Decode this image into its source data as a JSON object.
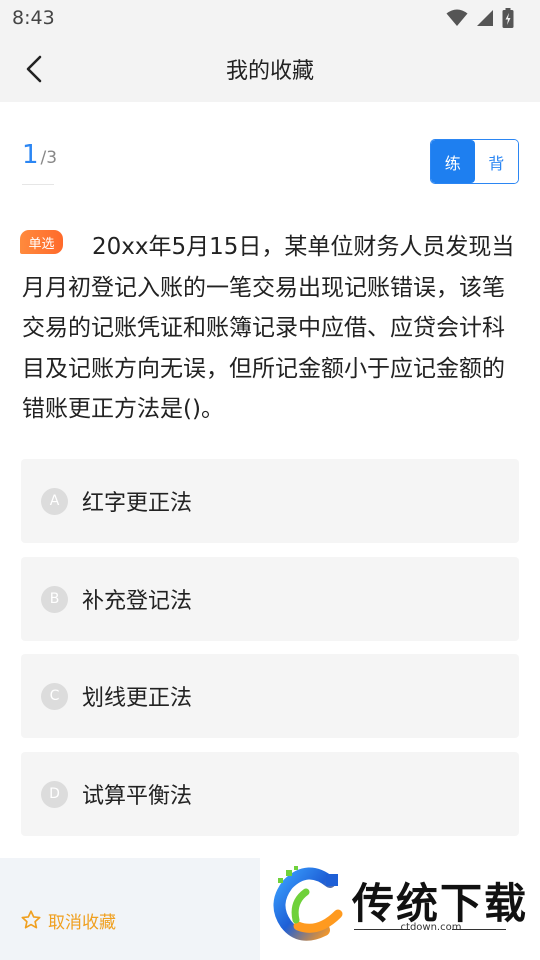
{
  "status_bar": {
    "time": "8:43"
  },
  "nav": {
    "title": "我的收藏"
  },
  "counter": {
    "current": "1",
    "total": "/3"
  },
  "mode": {
    "practice": "练",
    "recite": "背"
  },
  "question": {
    "type_badge": "单选",
    "text": "20xx年5月15日，某单位财务人员发现当月月初登记入账的一笔交易出现记账错误，该笔交易的记账凭证和账簿记录中应借、应贷会计科目及记账方向无误，但所记金额小于应记金额的错账更正方法是()。"
  },
  "options": [
    {
      "letter": "A",
      "text": "红字更正法"
    },
    {
      "letter": "B",
      "text": "补充登记法"
    },
    {
      "letter": "C",
      "text": "划线更正法"
    },
    {
      "letter": "D",
      "text": "试算平衡法"
    }
  ],
  "bottom": {
    "uncollect_label": "取消收藏"
  },
  "watermark": {
    "name": "传统下载",
    "url": "ctdown.com"
  },
  "colors": {
    "accent": "#2b86f3",
    "badge": "#ff7a33",
    "star": "#f0a020"
  }
}
